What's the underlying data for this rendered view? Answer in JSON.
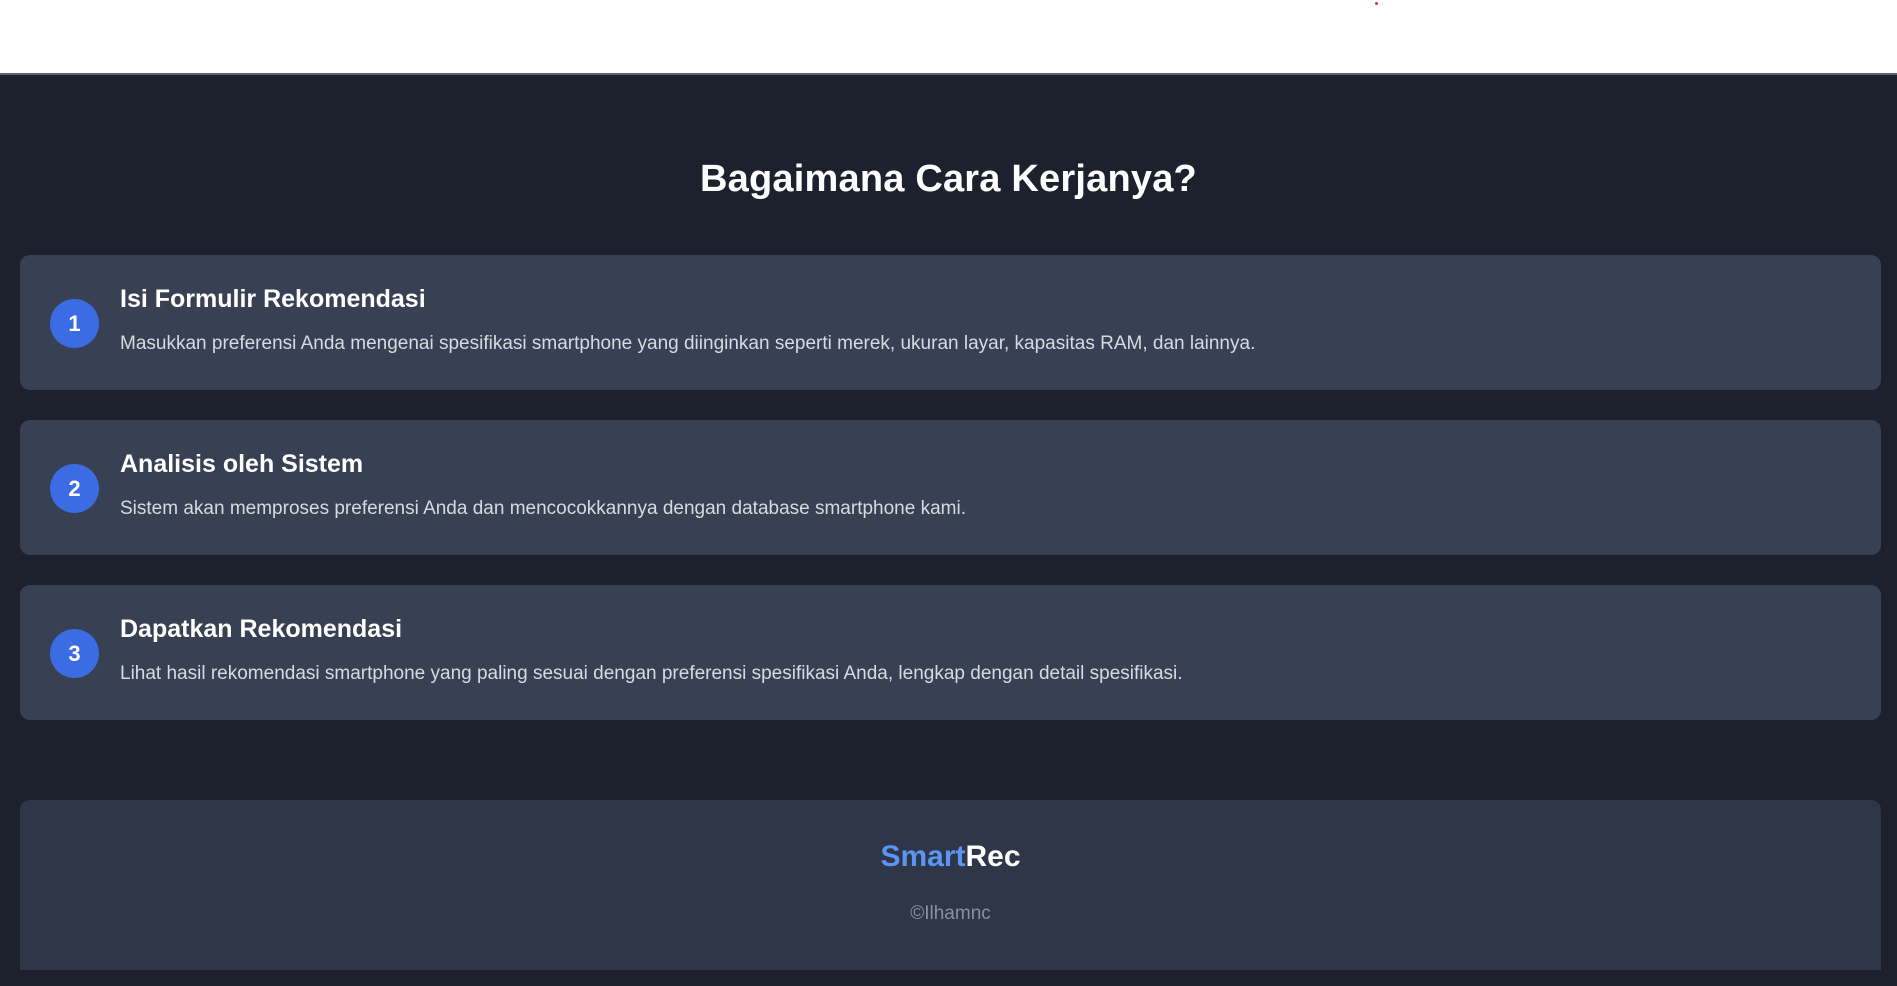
{
  "section": {
    "title": "Bagaimana Cara Kerjanya?"
  },
  "steps": [
    {
      "number": "1",
      "title": "Isi Formulir Rekomendasi",
      "description": "Masukkan preferensi Anda mengenai spesifikasi smartphone yang diinginkan seperti merek, ukuran layar, kapasitas RAM, dan lainnya."
    },
    {
      "number": "2",
      "title": "Analisis oleh Sistem",
      "description": "Sistem akan memproses preferensi Anda dan mencocokkannya dengan database smartphone kami."
    },
    {
      "number": "3",
      "title": "Dapatkan Rekomendasi",
      "description": "Lihat hasil rekomendasi smartphone yang paling sesuai dengan preferensi spesifikasi Anda, lengkap dengan detail spesifikasi."
    }
  ],
  "footer": {
    "brand_part1": "Smart",
    "brand_part2": "Rec",
    "copyright": "©Ilhamnc"
  },
  "colors": {
    "page_bg": "#1c212d",
    "card_bg": "#384153",
    "footer_bg": "#2e3647",
    "accent_blue": "#3b6ce3",
    "brand_blue": "#5b95f4"
  }
}
